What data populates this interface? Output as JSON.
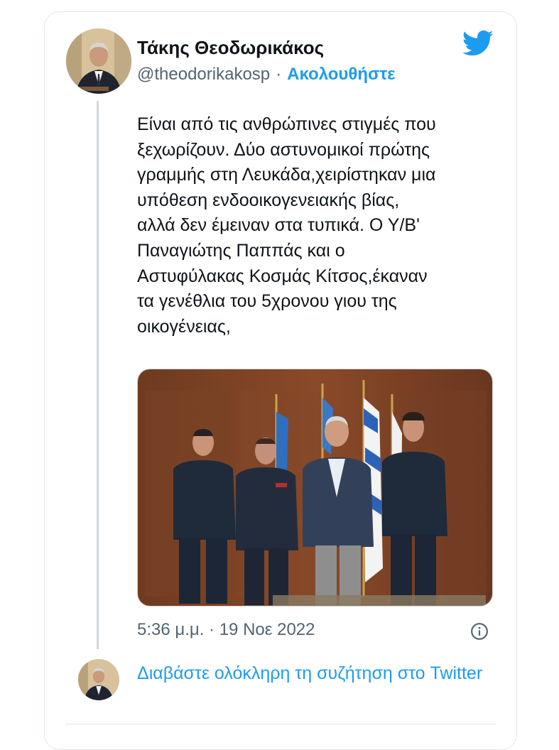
{
  "tweet": {
    "author_name": "Τάκης Θεοδωρικάκος",
    "handle": "@theodorikakosp",
    "separator": "·",
    "follow_label": "Ακολουθήστε",
    "text_lines": [
      "Είναι από τις ανθρώπινες στιγμές που",
      "ξεχωρίζουν. Δύο αστυνομικοί πρώτης",
      "γραμμής στη Λευκάδα,χειρίστηκαν μια",
      "υπόθεση ενδοοικογενειακής βίας,",
      "αλλά δεν έμειναν στα τυπικά. Ο Υ/Β'",
      "Παναγιώτης Παππάς και ο",
      "Αστυφύλακας Κοσμάς Κίτσος,έκαναν",
      "τα γενέθλια του 5χρονου γιου της",
      "οικογένειας,"
    ],
    "timestamp": "5:36 μ.μ. · 19 Νοε 2022",
    "read_more": "Διαβάστε ολόκληρη τη συζήτηση στο Twitter"
  },
  "icons": {
    "brand": "twitter-bird-icon",
    "info": "info-icon"
  },
  "colors": {
    "accent": "#1d9bf0",
    "secondary_text": "#536471",
    "primary_text": "#0f1419",
    "border": "#dfe6ea"
  }
}
